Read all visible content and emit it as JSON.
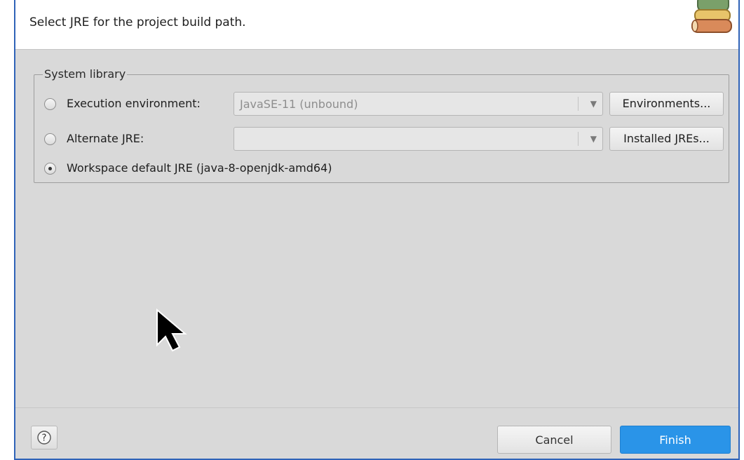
{
  "header": {
    "description": "Select JRE for the project build path.",
    "icon": "library-books-icon"
  },
  "system_library": {
    "label": "System library",
    "options": [
      {
        "label": "Execution environment:",
        "selected": false,
        "combo_value": "JavaSE-11 (unbound)",
        "button_label": "Environments..."
      },
      {
        "label": "Alternate JRE:",
        "selected": false,
        "combo_value": "",
        "button_label": "Installed JREs..."
      },
      {
        "label": "Workspace default JRE (java-8-openjdk-amd64)",
        "selected": true
      }
    ]
  },
  "footer": {
    "help_icon": "question-mark-icon",
    "cancel_label": "Cancel",
    "finish_label": "Finish"
  },
  "colors": {
    "accent": "#2a94e8",
    "window_border": "#2f63b8",
    "dialog_bg": "#d9d9d9"
  }
}
